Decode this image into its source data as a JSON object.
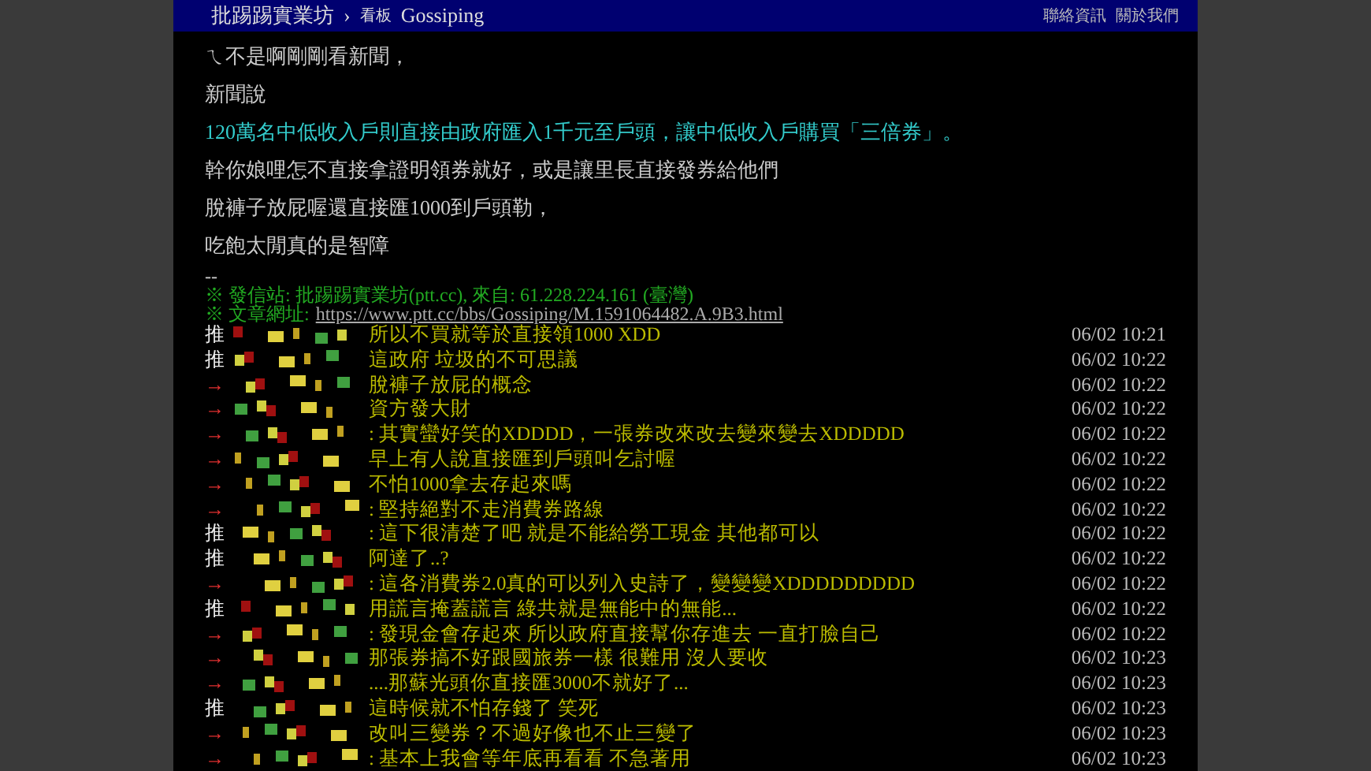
{
  "header": {
    "site": "批踢踢實業坊",
    "separator": "›",
    "board_label": "看板",
    "board": "Gossiping",
    "links": [
      "聯絡資訊",
      "關於我們"
    ]
  },
  "body": [
    {
      "text": "ㄟ不是啊剛剛看新聞，",
      "kind": "plain"
    },
    {
      "text": "新聞說",
      "kind": "plain"
    },
    {
      "text": "120萬名中低收入戶則直接由政府匯入1千元至戶頭，讓中低收入戶購買「三倍券」。",
      "kind": "quote"
    },
    {
      "text": "幹你娘哩怎不直接拿證明領券就好，或是讓里長直接發券給他們",
      "kind": "plain"
    },
    {
      "text": "脫褲子放屁喔還直接匯1000到戶頭勒，",
      "kind": "plain"
    },
    {
      "text": "吃飽太閒真的是智障",
      "kind": "plain"
    }
  ],
  "signature": {
    "dash": "--",
    "source": "※ 發信站: 批踢踢實業坊(ptt.cc), 來自: 61.228.224.161 (臺灣)",
    "url_label": "※ 文章網址:",
    "url": "https://www.ptt.cc/bbs/Gossiping/M.1591064482.A.9B3.html"
  },
  "comments": [
    {
      "tag": "推",
      "kind": "push",
      "content": "所以不買就等於直接領1000 XDD",
      "time": "06/02 10:21"
    },
    {
      "tag": "推",
      "kind": "push",
      "content": "這政府 垃圾的不可思議",
      "time": "06/02 10:22"
    },
    {
      "tag": "→",
      "kind": "arrow",
      "content": "脫褲子放屁的概念",
      "time": "06/02 10:22"
    },
    {
      "tag": "→",
      "kind": "arrow",
      "content": "資方發大財",
      "time": "06/02 10:22"
    },
    {
      "tag": "→",
      "kind": "arrow",
      "content": ": 其實蠻好笑的XDDDD，一張券改來改去變來變去XDDDDD",
      "time": "06/02 10:22"
    },
    {
      "tag": "→",
      "kind": "arrow",
      "content": "早上有人說直接匯到戶頭叫乞討喔",
      "time": "06/02 10:22"
    },
    {
      "tag": "→",
      "kind": "arrow",
      "content": "不怕1000拿去存起來嗎",
      "time": "06/02 10:22"
    },
    {
      "tag": "→",
      "kind": "arrow",
      "content": ": 堅持絕對不走消費券路線",
      "time": "06/02 10:22"
    },
    {
      "tag": "推",
      "kind": "push",
      "content": ": 這下很清楚了吧 就是不能給勞工現金 其他都可以",
      "time": "06/02 10:22"
    },
    {
      "tag": "推",
      "kind": "push",
      "content": "阿達了..?",
      "time": "06/02 10:22"
    },
    {
      "tag": "→",
      "kind": "arrow",
      "content": ": 這各消費券2.0真的可以列入史詩了，變變變XDDDDDDDDD",
      "time": "06/02 10:22"
    },
    {
      "tag": "推",
      "kind": "push",
      "content": "用謊言掩蓋謊言 綠共就是無能中的無能...",
      "time": "06/02 10:22"
    },
    {
      "tag": "→",
      "kind": "arrow",
      "content": ": 發現金會存起來 所以政府直接幫你存進去 一直打臉自己",
      "time": "06/02 10:22"
    },
    {
      "tag": "→",
      "kind": "arrow",
      "content": "那張券搞不好跟國旅券一樣 很難用 沒人要收",
      "time": "06/02 10:23"
    },
    {
      "tag": "→",
      "kind": "arrow",
      "content": "....那蘇光頭你直接匯3000不就好了...",
      "time": "06/02 10:23"
    },
    {
      "tag": "推",
      "kind": "push",
      "content": "這時候就不怕存錢了 笑死",
      "time": "06/02 10:23"
    },
    {
      "tag": "→",
      "kind": "arrow",
      "content": "改叫三變券？不過好像也不止三變了",
      "time": "06/02 10:23"
    },
    {
      "tag": "→",
      "kind": "arrow",
      "content": ": 基本上我會等年底再看看 不急著用",
      "time": "06/02 10:23"
    }
  ]
}
